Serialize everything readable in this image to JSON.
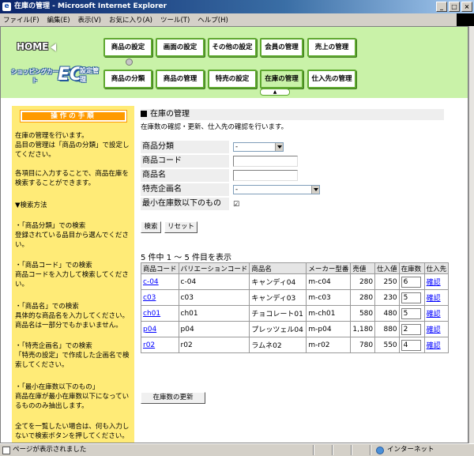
{
  "window": {
    "title": "在庫の管理 - Microsoft Internet Explorer",
    "controls": [
      "_",
      "□",
      "×"
    ]
  },
  "menu": [
    "ファイル(F)",
    "編集(E)",
    "表示(V)",
    "お気に入り(A)",
    "ツール(T)",
    "ヘルプ(H)"
  ],
  "header": {
    "home_label": "HOME",
    "logo": {
      "small": "ショッピングカート",
      "ec": "EC",
      "side": "設定管理"
    },
    "nav_row1": [
      "商品の設定",
      "画面の設定",
      "その他の設定",
      "会員の管理",
      "売上の管理"
    ],
    "nav_row2": [
      "商品の分類",
      "商品の管理",
      "特売の設定",
      "在庫の管理",
      "仕入先の管理"
    ],
    "active_nav": "在庫の管理"
  },
  "sidebar": {
    "title": "操作の手順",
    "paragraphs": [
      "在庫の管理を行います。\n品目の管理は「商品の分類」で設定してください。",
      "各項目に入力することで、商品在庫を検索することができます。",
      "▼検索方法",
      "・「商品分類」での検索\n登録されている品目から選んでください。",
      "・「商品コード」での検索\n商品コードを入力して検索してください。",
      "・「商品名」での検索\n具体的な商品名を入力してください。\n商品名は一部分でもかまいません。",
      "・「特売企画名」での検索\n「特売の設定」で作成した企画名で検索してください。",
      "・「最小在庫数以下のもの」\n商品在庫が最小在庫数以下になっているもののみ抽出します。",
      "全てを一覧したい場合は、何も入力しないで検索ボタンを押してください。"
    ]
  },
  "main": {
    "title": "在庫の管理",
    "subtitle": "在庫数の確認・更新、仕入先の確認を行います。",
    "form": {
      "category_label": "商品分類",
      "category_value": "-",
      "code_label": "商品コード",
      "code_value": "",
      "name_label": "商品名",
      "name_value": "",
      "campaign_label": "特売企画名",
      "campaign_value": "-",
      "minstock_label": "最小在庫数以下のもの",
      "minstock_checked": "☑"
    },
    "search_button": "検索",
    "reset_button": "リセット",
    "result_count": "5 件中 1 ～ 5 件目を表示",
    "table": {
      "headers": [
        "商品コード",
        "バリエーションコード",
        "商品名",
        "メーカー型番",
        "売値",
        "仕入値",
        "在庫数",
        "仕入先"
      ],
      "rows": [
        {
          "code": "c-04",
          "variation": "c-04",
          "name": "キャンディ04",
          "model": "m-c04",
          "price": "280",
          "cost": "250",
          "stock": "6",
          "supplier": "確認"
        },
        {
          "code": "c03",
          "variation": "c03",
          "name": "キャンディ03",
          "model": "m-c03",
          "price": "280",
          "cost": "230",
          "stock": "5",
          "supplier": "確認"
        },
        {
          "code": "ch01",
          "variation": "ch01",
          "name": "チョコレート01",
          "model": "m-ch01",
          "price": "580",
          "cost": "480",
          "stock": "5",
          "supplier": "確認"
        },
        {
          "code": "p04",
          "variation": "p04",
          "name": "プレッツェル04",
          "model": "m-p04",
          "price": "1,180",
          "cost": "880",
          "stock": "2",
          "supplier": "確認"
        },
        {
          "code": "r02",
          "variation": "r02",
          "name": "ラムネ02",
          "model": "m-r02",
          "price": "780",
          "cost": "550",
          "stock": "4",
          "supplier": "確認"
        }
      ]
    },
    "update_button": "在庫数の更新"
  },
  "status": {
    "left": "ページが表示されました",
    "zone": "インターネット"
  }
}
